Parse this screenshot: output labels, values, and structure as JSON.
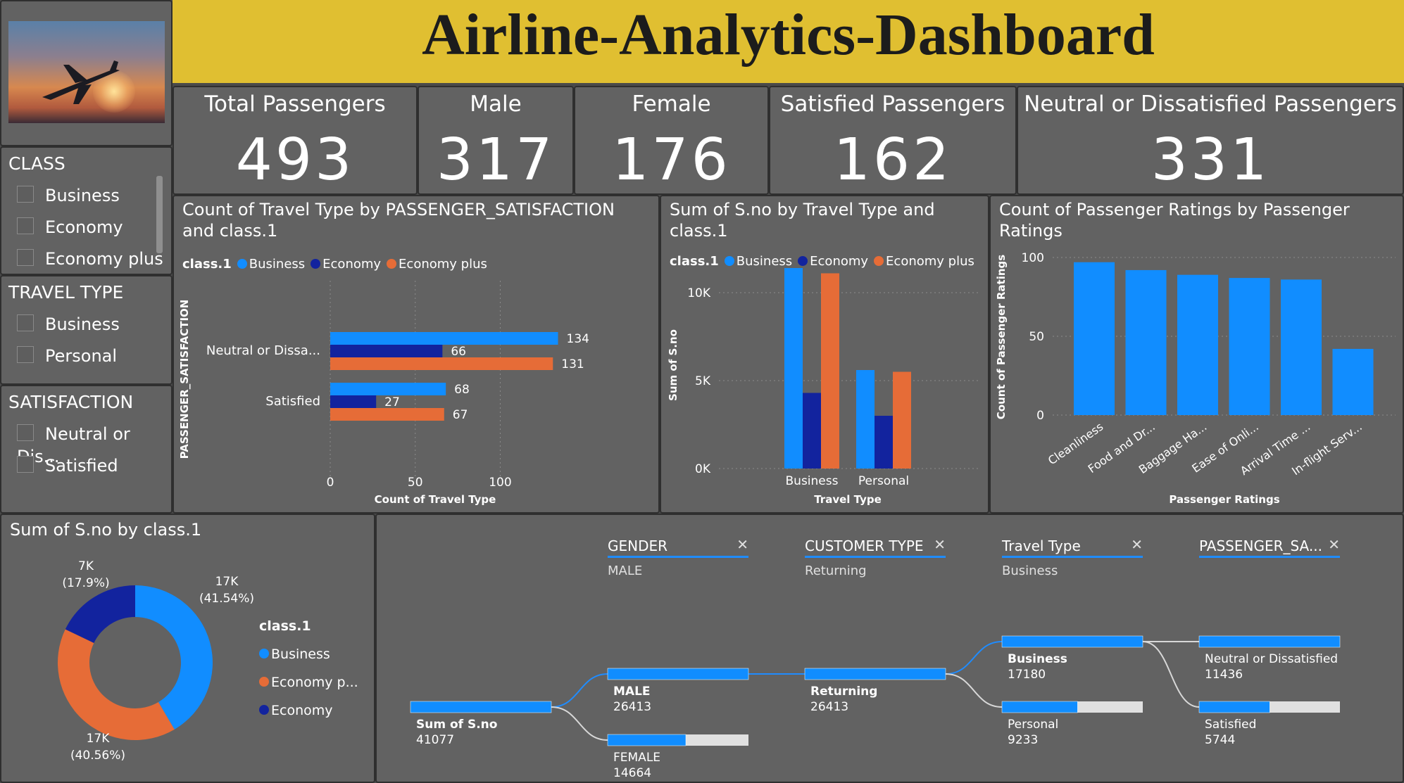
{
  "title": "Airline-Analytics-Dashboard",
  "kpis": [
    {
      "label": "Total Passengers",
      "value": "493"
    },
    {
      "label": "Male",
      "value": "317"
    },
    {
      "label": "Female",
      "value": "176"
    },
    {
      "label": "Satisfied Passengers",
      "value": "162"
    },
    {
      "label": "Neutral or Dissatisfied Passengers",
      "value": "331"
    }
  ],
  "slicers": {
    "class": {
      "title": "CLASS",
      "options": [
        "Business",
        "Economy",
        "Economy plus"
      ]
    },
    "travel_type": {
      "title": "TRAVEL TYPE",
      "options": [
        "Business",
        "Personal"
      ]
    },
    "satisfaction": {
      "title": "SATISFACTION",
      "options": [
        "Neutral or Dis...",
        "Satisfied"
      ]
    }
  },
  "colors": {
    "business": "#118dff",
    "economy": "#12239e",
    "economy_plus": "#e66c37"
  },
  "chart_data": [
    {
      "type": "bar",
      "orientation": "horizontal",
      "title": "Count of Travel Type by PASSENGER_SATISFACTION and class.1",
      "legend_title": "class.1",
      "legend": [
        "Business",
        "Economy",
        "Economy plus"
      ],
      "categories": [
        "Neutral or Dissa...",
        "Satisfied"
      ],
      "series": [
        {
          "name": "Business",
          "values": [
            134,
            68
          ]
        },
        {
          "name": "Economy",
          "values": [
            66,
            27
          ]
        },
        {
          "name": "Economy plus",
          "values": [
            131,
            67
          ]
        }
      ],
      "xlabel": "Count of Travel Type",
      "ylabel": "PASSENGER_SATISFACTION",
      "xlim": [
        0,
        140
      ],
      "xticks": [
        "0",
        "50",
        "100"
      ],
      "grid": true
    },
    {
      "type": "bar",
      "title": "Sum of S.no by Travel Type and class.1",
      "legend_title": "class.1",
      "legend": [
        "Business",
        "Economy",
        "Economy plus"
      ],
      "categories": [
        "Business",
        "Personal"
      ],
      "series": [
        {
          "name": "Business",
          "values": [
            11400,
            5600
          ]
        },
        {
          "name": "Economy",
          "values": [
            4300,
            3000
          ]
        },
        {
          "name": "Economy plus",
          "values": [
            11100,
            5500
          ]
        }
      ],
      "xlabel": "Travel Type",
      "ylabel": "Sum of S.no",
      "ylim": [
        0,
        12000
      ],
      "yticks": [
        "0K",
        "5K",
        "10K"
      ],
      "grid": true
    },
    {
      "type": "bar",
      "title": "Count of Passenger Ratings by Passenger Ratings",
      "categories": [
        "Cleanliness",
        "Food and Dr...",
        "Baggage Ha...",
        "Ease of Onli...",
        "Arrival Time ...",
        "In-flight Serv..."
      ],
      "values": [
        97,
        92,
        89,
        87,
        86,
        42
      ],
      "xlabel": "Passenger Ratings",
      "ylabel": "Count of Passenger Ratings",
      "ylim": [
        0,
        100
      ],
      "yticks": [
        "0",
        "50",
        "100"
      ],
      "grid": true
    },
    {
      "type": "pie",
      "donut": true,
      "title": "Sum of S.no by class.1",
      "legend_title": "class.1",
      "legend": [
        "Business",
        "Economy p...",
        "Economy"
      ],
      "slices": [
        {
          "name": "Business",
          "value": 17000,
          "label": "17K",
          "pct": "(41.54%)"
        },
        {
          "name": "Economy plus",
          "value": 17000,
          "label": "17K",
          "pct": "(40.56%)"
        },
        {
          "name": "Economy",
          "value": 7000,
          "label": "7K",
          "pct": "(17.9%)"
        }
      ],
      "fractions": [
        0.4154,
        0.4056,
        0.179
      ]
    }
  ],
  "decomp": {
    "columns": [
      {
        "header": "GENDER",
        "value": "MALE"
      },
      {
        "header": "CUSTOMER TYPE",
        "value": "Returning"
      },
      {
        "header": "Travel Type",
        "value": "Business"
      },
      {
        "header": "PASSENGER_SA...",
        "value": ""
      }
    ],
    "close_glyph": "✕",
    "root": {
      "label": "Sum of S.no",
      "value": "41077"
    },
    "nodes": {
      "male": {
        "label": "MALE",
        "value": "26413",
        "fraction": 1.0
      },
      "female": {
        "label": "FEMALE",
        "value": "14664",
        "fraction": 0.555
      },
      "returning": {
        "label": "Returning",
        "value": "26413",
        "fraction": 1.0
      },
      "business": {
        "label": "Business",
        "value": "17180",
        "fraction": 1.0
      },
      "personal": {
        "label": "Personal",
        "value": "9233",
        "fraction": 0.537
      },
      "neutral": {
        "label": "Neutral or Dissatisfied",
        "value": "11436",
        "fraction": 1.0
      },
      "satisfied": {
        "label": "Satisfied",
        "value": "5744",
        "fraction": 0.502
      }
    }
  }
}
